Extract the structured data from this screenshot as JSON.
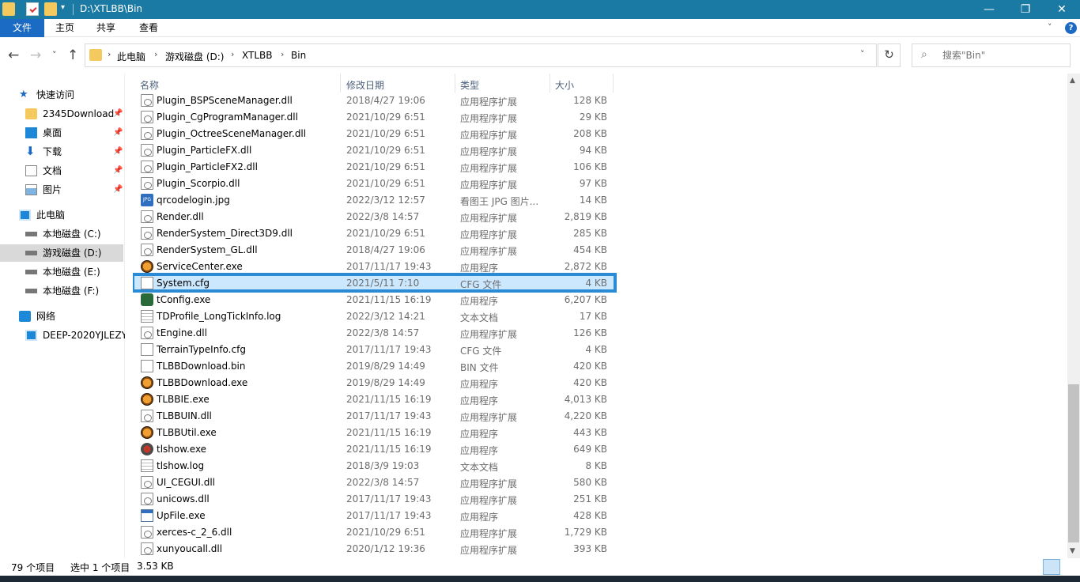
{
  "window": {
    "title": "D:\\XTLBB\\Bin",
    "minimize": "—",
    "maximize": "❐",
    "close": "✕"
  },
  "ribbon": {
    "tabs": [
      "文件",
      "主页",
      "共享",
      "查看"
    ],
    "help": "?"
  },
  "nav": {
    "back": "←",
    "forward": "→",
    "recent": "˅",
    "up": "↑",
    "breadcrumb": [
      "此电脑",
      "游戏磁盘 (D:)",
      "XTLBB",
      "Bin"
    ],
    "refresh": "↻",
    "search_placeholder": "搜索\"Bin\""
  },
  "sidebar": {
    "quick_access": "快速访问",
    "quick_items": [
      "2345Download",
      "桌面",
      "下载",
      "文档",
      "图片"
    ],
    "this_pc": "此电脑",
    "drives": [
      "本地磁盘 (C:)",
      "游戏磁盘 (D:)",
      "本地磁盘 (E:)",
      "本地磁盘 (F:)"
    ],
    "network": "网络",
    "network_items": [
      "DEEP-2020YJLEZY"
    ]
  },
  "columns": {
    "name": "名称",
    "date": "修改日期",
    "type": "类型",
    "size": "大小"
  },
  "files": [
    {
      "name": "Plugin_BSPSceneManager.dll",
      "date": "2018/4/27 19:06",
      "type": "应用程序扩展",
      "size": "128 KB",
      "icon": "dll-icon"
    },
    {
      "name": "Plugin_CgProgramManager.dll",
      "date": "2021/10/29 6:51",
      "type": "应用程序扩展",
      "size": "29 KB",
      "icon": "dll-icon"
    },
    {
      "name": "Plugin_OctreeSceneManager.dll",
      "date": "2021/10/29 6:51",
      "type": "应用程序扩展",
      "size": "208 KB",
      "icon": "dll-icon"
    },
    {
      "name": "Plugin_ParticleFX.dll",
      "date": "2021/10/29 6:51",
      "type": "应用程序扩展",
      "size": "94 KB",
      "icon": "dll-icon"
    },
    {
      "name": "Plugin_ParticleFX2.dll",
      "date": "2021/10/29 6:51",
      "type": "应用程序扩展",
      "size": "106 KB",
      "icon": "dll-icon"
    },
    {
      "name": "Plugin_Scorpio.dll",
      "date": "2021/10/29 6:51",
      "type": "应用程序扩展",
      "size": "97 KB",
      "icon": "dll-icon"
    },
    {
      "name": "qrcodelogin.jpg",
      "date": "2022/3/12 12:57",
      "type": "看图王 JPG 图片...",
      "size": "14 KB",
      "icon": "jpg-icon"
    },
    {
      "name": "Render.dll",
      "date": "2022/3/8 14:57",
      "type": "应用程序扩展",
      "size": "2,819 KB",
      "icon": "dll-icon"
    },
    {
      "name": "RenderSystem_Direct3D9.dll",
      "date": "2021/10/29 6:51",
      "type": "应用程序扩展",
      "size": "285 KB",
      "icon": "dll-icon"
    },
    {
      "name": "RenderSystem_GL.dll",
      "date": "2018/4/27 19:06",
      "type": "应用程序扩展",
      "size": "454 KB",
      "icon": "dll-icon"
    },
    {
      "name": "ServiceCenter.exe",
      "date": "2017/11/17 19:43",
      "type": "应用程序",
      "size": "2,872 KB",
      "icon": "tiger-icon"
    },
    {
      "name": "System.cfg",
      "date": "2021/5/11 7:10",
      "type": "CFG 文件",
      "size": "4 KB",
      "icon": "file-icon",
      "selected": true
    },
    {
      "name": "tConfig.exe",
      "date": "2021/11/15 16:19",
      "type": "应用程序",
      "size": "6,207 KB",
      "icon": "gear-icon"
    },
    {
      "name": "TDProfile_LongTickInfo.log",
      "date": "2022/3/12 14:21",
      "type": "文本文档",
      "size": "17 KB",
      "icon": "log-icon"
    },
    {
      "name": "tEngine.dll",
      "date": "2022/3/8 14:57",
      "type": "应用程序扩展",
      "size": "126 KB",
      "icon": "dll-icon"
    },
    {
      "name": "TerrainTypeInfo.cfg",
      "date": "2017/11/17 19:43",
      "type": "CFG 文件",
      "size": "4 KB",
      "icon": "file-icon"
    },
    {
      "name": "TLBBDownload.bin",
      "date": "2019/8/29 14:49",
      "type": "BIN 文件",
      "size": "420 KB",
      "icon": "file-icon"
    },
    {
      "name": "TLBBDownload.exe",
      "date": "2019/8/29 14:49",
      "type": "应用程序",
      "size": "420 KB",
      "icon": "tiger-icon"
    },
    {
      "name": "TLBBIE.exe",
      "date": "2021/11/15 16:19",
      "type": "应用程序",
      "size": "4,013 KB",
      "icon": "tiger-icon"
    },
    {
      "name": "TLBBUIN.dll",
      "date": "2017/11/17 19:43",
      "type": "应用程序扩展",
      "size": "4,220 KB",
      "icon": "dll-icon"
    },
    {
      "name": "TLBBUtil.exe",
      "date": "2021/11/15 16:19",
      "type": "应用程序",
      "size": "443 KB",
      "icon": "tiger-icon"
    },
    {
      "name": "tlshow.exe",
      "date": "2021/11/15 16:19",
      "type": "应用程序",
      "size": "649 KB",
      "icon": "red-app-icon"
    },
    {
      "name": "tlshow.log",
      "date": "2018/3/9 19:03",
      "type": "文本文档",
      "size": "8 KB",
      "icon": "log-icon"
    },
    {
      "name": "UI_CEGUI.dll",
      "date": "2022/3/8 14:57",
      "type": "应用程序扩展",
      "size": "580 KB",
      "icon": "dll-icon"
    },
    {
      "name": "unicows.dll",
      "date": "2017/11/17 19:43",
      "type": "应用程序扩展",
      "size": "251 KB",
      "icon": "dll-icon"
    },
    {
      "name": "UpFile.exe",
      "date": "2017/11/17 19:43",
      "type": "应用程序",
      "size": "428 KB",
      "icon": "window-app-icon"
    },
    {
      "name": "xerces-c_2_6.dll",
      "date": "2021/10/29 6:51",
      "type": "应用程序扩展",
      "size": "1,729 KB",
      "icon": "dll-icon"
    },
    {
      "name": "xunyoucall.dll",
      "date": "2020/1/12 19:36",
      "type": "应用程序扩展",
      "size": "393 KB",
      "icon": "dll-icon"
    }
  ],
  "status": {
    "item_count": "79 个项目",
    "selection": "选中 1 个项目",
    "selection_size": "3.53 KB"
  },
  "colors": {
    "titlebar": "#1b7aa3",
    "file_tab": "#1b6ac4",
    "selection_fill": "#cce8ff",
    "selection_border": "#2a8ad4"
  }
}
